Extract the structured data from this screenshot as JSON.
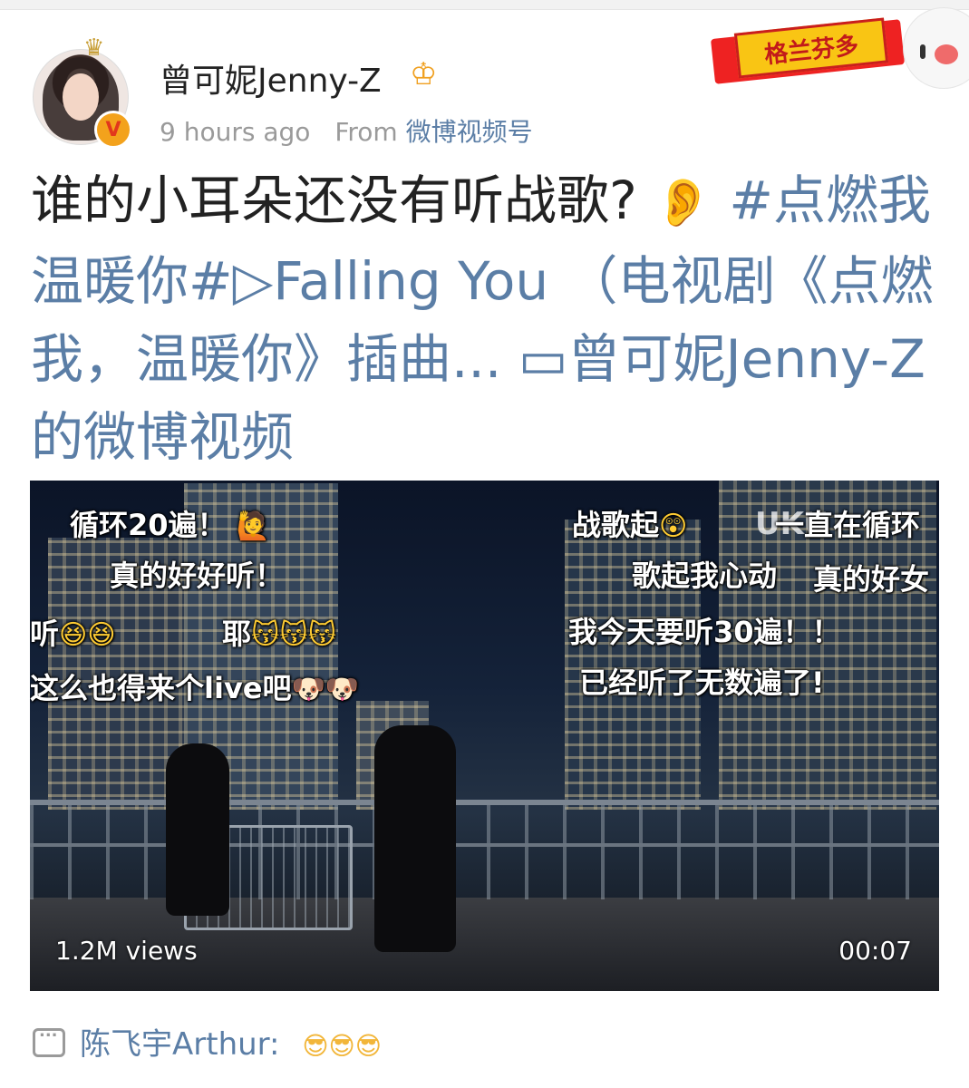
{
  "header": {
    "username": "曾可妮Jenny-Z",
    "time": "9 hours ago",
    "from_label": "From",
    "source": "微博视频号",
    "banner_text": "格兰芬多",
    "verified_mark": "V"
  },
  "post": {
    "text": "谁的小耳朵还没有听战歌?",
    "hashtag": "#点燃我温暖你#",
    "song_link": "▷Falling You （电视剧《点燃我，温暖你》插曲...",
    "video_link": "▭曾可妮Jenny-Z的微博视频"
  },
  "video": {
    "views": "1.2M views",
    "duration": "00:07",
    "watermark": "UKU",
    "danmaku_left": [
      "循环20遍！",
      "真的好好听！",
      "听",
      "耶",
      "这么也得来个live吧"
    ],
    "danmaku_right": [
      "战歌起",
      "一直在循环",
      "歌起我心动",
      "真的好女",
      "我今天要听30遍！！",
      "已经听了无数遍了!"
    ]
  },
  "comment": {
    "author": "陈飞宇Arthur:",
    "emojis": "😎😎😎"
  },
  "colors": {
    "link": "#5b7ea6",
    "meta": "#9a9a9a",
    "text": "#222222"
  },
  "icons": [
    "crown-icon",
    "ear-icon",
    "comment-icon",
    "mascot-icon",
    "play-triangle-icon",
    "video-camera-icon"
  ]
}
